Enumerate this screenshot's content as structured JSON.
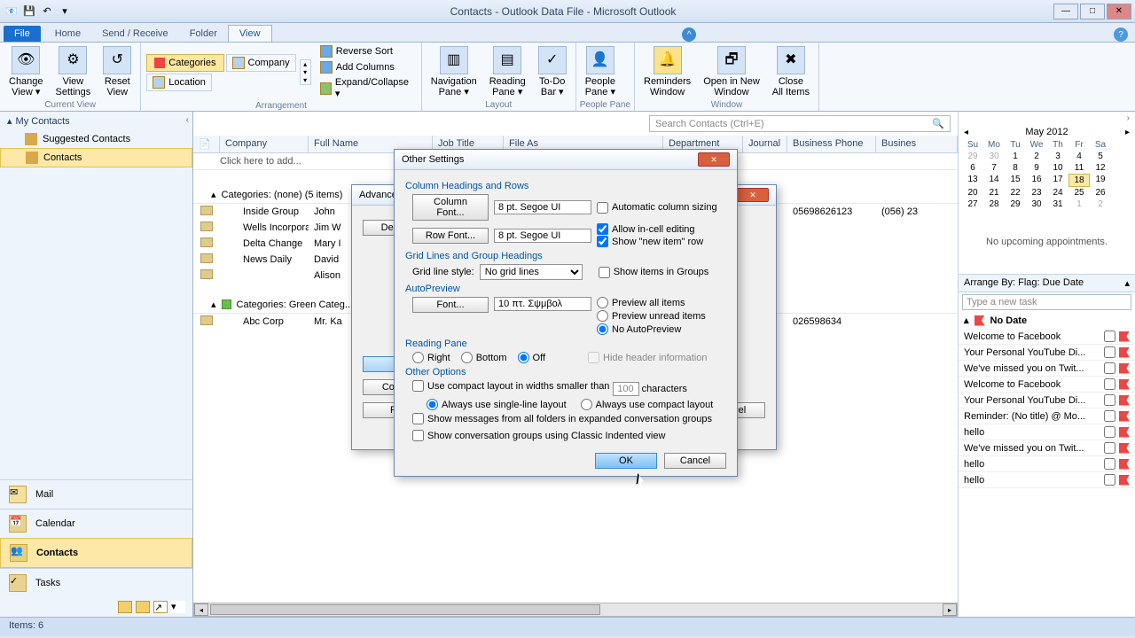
{
  "window": {
    "title": "Contacts - Outlook Data File - Microsoft Outlook"
  },
  "tabs": {
    "file": "File",
    "home": "Home",
    "sendrecv": "Send / Receive",
    "folder": "Folder",
    "view": "View"
  },
  "ribbon": {
    "change_view": "Change\nView ▾",
    "view_settings": "View\nSettings",
    "reset_view": "Reset\nView",
    "group_current": "Current View",
    "categories": "Categories",
    "company": "Company",
    "location": "Location",
    "reverse_sort": "Reverse Sort",
    "add_columns": "Add Columns",
    "expand_collapse": "Expand/Collapse ▾",
    "group_arrangement": "Arrangement",
    "nav_pane": "Navigation\nPane ▾",
    "reading_pane": "Reading\nPane ▾",
    "todo_bar": "To-Do\nBar ▾",
    "group_layout": "Layout",
    "people_pane": "People\nPane ▾",
    "group_people": "People Pane",
    "reminders": "Reminders\nWindow",
    "new_window": "Open in New\nWindow",
    "close_all": "Close\nAll Items",
    "group_window": "Window"
  },
  "nav": {
    "my_contacts": "My Contacts",
    "suggested": "Suggested Contacts",
    "contacts": "Contacts",
    "mail": "Mail",
    "calendar": "Calendar",
    "tasks": "Tasks"
  },
  "search": {
    "placeholder": "Search Contacts (Ctrl+E)"
  },
  "columns": {
    "company": "Company",
    "full_name": "Full Name",
    "job_title": "Job Title",
    "file_as": "File As",
    "department": "Department",
    "journal": "Journal",
    "business_phone": "Business Phone",
    "business": "Busines"
  },
  "addrow": "Click here to add...",
  "cat_none": "Categories: (none) (5 items)",
  "rows_none": [
    {
      "company": "Inside Group",
      "name": "John",
      "phone": "05698626123",
      "ext": "(056) 23"
    },
    {
      "company": "Wells Incorporat...",
      "name": "Jim W",
      "phone": "",
      "ext": ""
    },
    {
      "company": "Delta Change",
      "name": "Mary I",
      "phone": "",
      "ext": ""
    },
    {
      "company": "News Daily",
      "name": "David",
      "phone": "",
      "ext": ""
    },
    {
      "company": "",
      "name": "Alison",
      "phone": "",
      "ext": ""
    }
  ],
  "cat_green": "Categories: Green Categ...",
  "rows_green": [
    {
      "company": "Abc Corp",
      "name": "Mr. Ka",
      "phone": "026598634",
      "ext": ""
    }
  ],
  "advanced_dialog": {
    "title": "Advanced",
    "descr": "Descr",
    "cond": "Cond",
    "r": "R",
    "cancel": "ancel"
  },
  "calendar": {
    "month": "May 2012",
    "days": [
      "Su",
      "Mo",
      "Tu",
      "We",
      "Th",
      "Fr",
      "Sa"
    ],
    "prev": [
      29,
      30
    ],
    "dates": [
      1,
      2,
      3,
      4,
      5,
      6,
      7,
      8,
      9,
      10,
      11,
      12,
      13,
      14,
      15,
      16,
      17,
      18,
      19,
      20,
      21,
      22,
      23,
      24,
      25,
      26,
      27,
      28,
      29,
      30,
      31
    ],
    "next": [
      1,
      2
    ],
    "today": 18,
    "no_appt": "No upcoming appointments."
  },
  "tasks": {
    "arrange": "Arrange By: Flag: Due Date",
    "new_task": "Type a new task",
    "no_date": "No Date",
    "items": [
      "Welcome to Facebook",
      "Your Personal YouTube Di...",
      "We've missed you on Twit...",
      "Welcome to Facebook",
      "Your Personal YouTube Di...",
      "Reminder: (No title) @ Mo...",
      "hello",
      "We've missed you on Twit...",
      "hello",
      "hello"
    ]
  },
  "statusbar": {
    "items": "Items: 6"
  },
  "dialog": {
    "title": "Other Settings",
    "col_headings": "Column Headings and Rows",
    "column_font": "Column Font...",
    "row_font": "Row Font...",
    "col_font_val": "8 pt. Segoe UI",
    "row_font_val": "8 pt. Segoe UI",
    "auto_col": "Automatic column sizing",
    "allow_incell": "Allow in-cell editing",
    "show_new": "Show \"new item\" row",
    "grid_lines_hdr": "Grid Lines and Group Headings",
    "grid_style": "Grid line style:",
    "grid_style_val": "No grid lines",
    "show_groups": "Show items in Groups",
    "autopreview": "AutoPreview",
    "font": "Font...",
    "ap_font_val": "10 πτ. Σψμβολ",
    "preview_all": "Preview all items",
    "preview_unread": "Preview unread items",
    "no_ap": "No AutoPreview",
    "reading_pane": "Reading Pane",
    "right": "Right",
    "bottom": "Bottom",
    "off": "Off",
    "hide_header": "Hide header information",
    "other_options": "Other Options",
    "use_compact": "Use compact layout in widths smaller than",
    "compact_val": "100",
    "characters": "characters",
    "always_single": "Always use single-line layout",
    "always_compact": "Always use compact layout",
    "show_msgs": "Show messages from all folders in expanded conversation groups",
    "show_conv": "Show conversation groups using Classic Indented view",
    "ok": "OK",
    "cancel": "Cancel"
  }
}
